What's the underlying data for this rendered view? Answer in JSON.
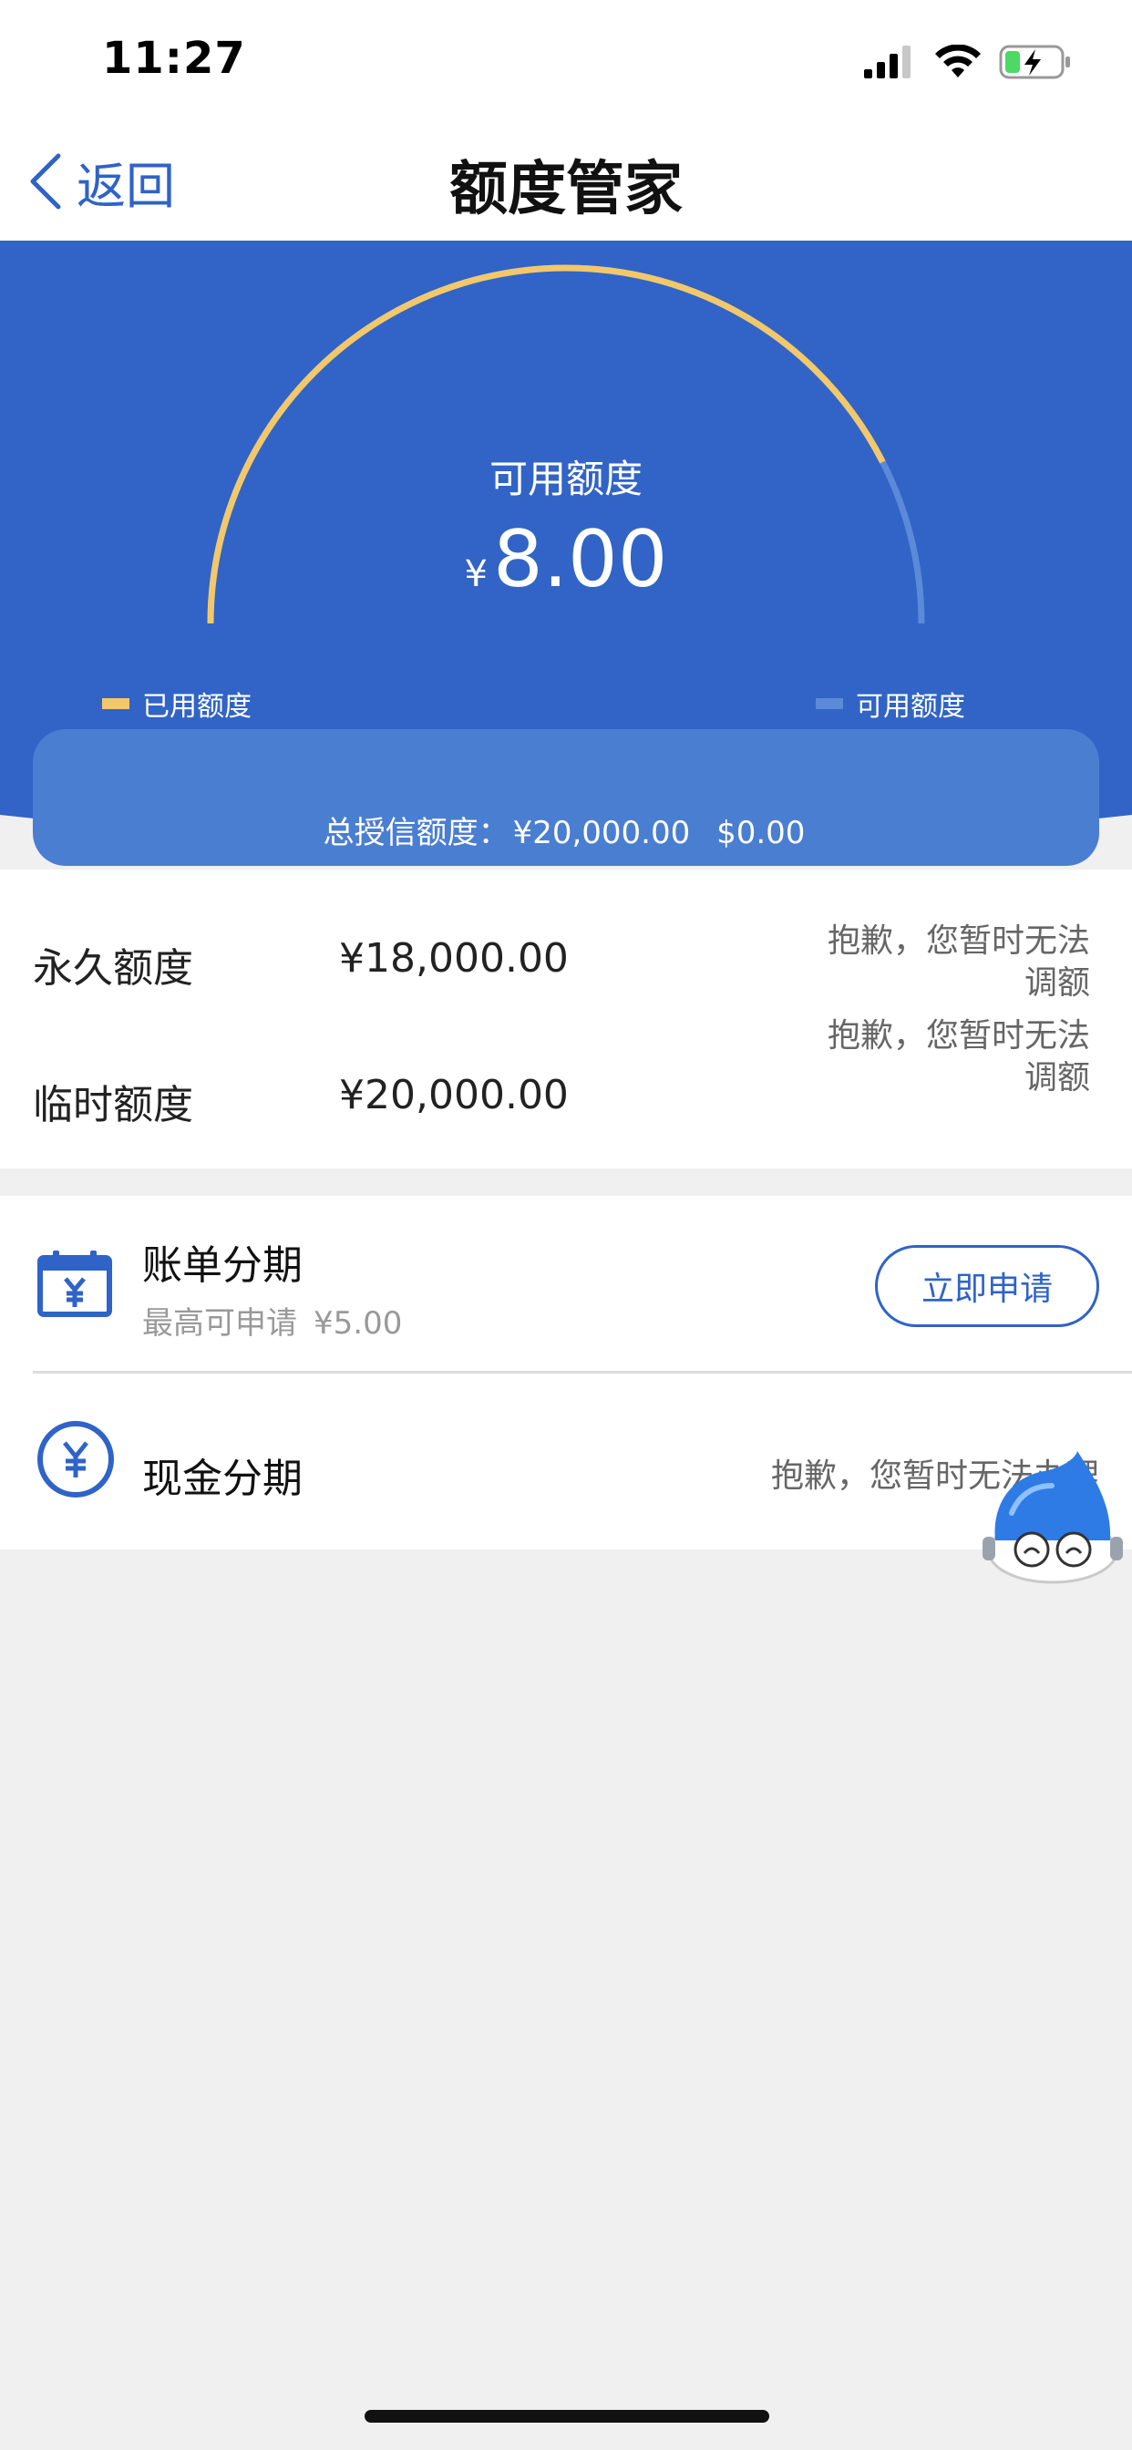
{
  "status_bar": {
    "time": "11:27"
  },
  "nav": {
    "back_label": "返回",
    "title": "额度管家"
  },
  "hero": {
    "gauge_label": "可用额度",
    "currency": "¥",
    "available_amount": "8.00",
    "legend_used": "已用额度",
    "legend_available": "可用额度",
    "total_label": "总授信额度：",
    "total_amount": "¥20,000.00",
    "total_extra": "$0.00",
    "used_fraction": 0.85,
    "colors": {
      "background": "#3164c6",
      "used": "#f2c86b",
      "available": "#5a8ad8"
    }
  },
  "quota": [
    {
      "name": "永久额度",
      "amount": "¥18,000.00",
      "note_line1": "抱歉，您暂时无法",
      "note_line2": "调额"
    },
    {
      "name": "临时额度",
      "amount": "¥20,000.00",
      "note_line1": "抱歉，您暂时无法",
      "note_line2": "调额"
    }
  ],
  "installments": {
    "bill": {
      "icon": "calendar-yen-icon",
      "title": "账单分期",
      "subtitle_label": "最高可申请",
      "subtitle_amount": "¥5.00",
      "button": "立即申请"
    },
    "cash": {
      "icon": "yen-circle-icon",
      "title": "现金分期",
      "note": "抱歉，您暂时无法办理"
    }
  },
  "accent_color": "#2f63c8"
}
